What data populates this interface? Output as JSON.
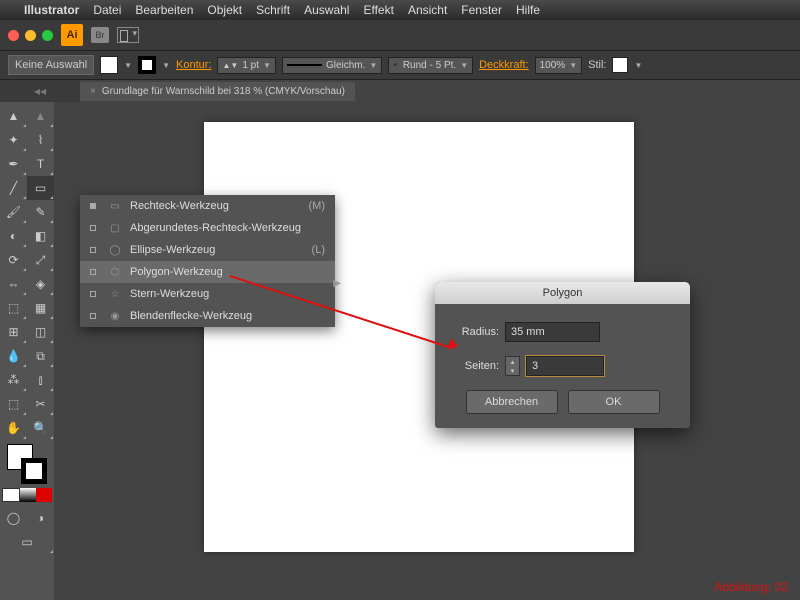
{
  "menubar": {
    "app": "Illustrator",
    "items": [
      "Datei",
      "Bearbeiten",
      "Objekt",
      "Schrift",
      "Auswahl",
      "Effekt",
      "Ansicht",
      "Fenster",
      "Hilfe"
    ]
  },
  "controlbar": {
    "selection": "Keine Auswahl",
    "stroke_label": "Kontur:",
    "stroke_val": "1 pt",
    "dash_label": "Gleichm.",
    "brush_label": "Rund - 5 Pt.",
    "opacity_label": "Deckkraft:",
    "opacity_val": "100%",
    "style_label": "Stil:"
  },
  "doctab": {
    "title": "Grundlage für Warnschild bei 318 % (CMYK/Vorschau)"
  },
  "context_menu": {
    "items": [
      {
        "label": "Rechteck-Werkzeug",
        "shortcut": "(M)",
        "icon": "▭"
      },
      {
        "label": "Abgerundetes-Rechteck-Werkzeug",
        "shortcut": "",
        "icon": "▢"
      },
      {
        "label": "Ellipse-Werkzeug",
        "shortcut": "(L)",
        "icon": "◯"
      },
      {
        "label": "Polygon-Werkzeug",
        "shortcut": "",
        "icon": "⬡"
      },
      {
        "label": "Stern-Werkzeug",
        "shortcut": "",
        "icon": "☆"
      },
      {
        "label": "Blendenflecke-Werkzeug",
        "shortcut": "",
        "icon": "◉"
      }
    ]
  },
  "dialog": {
    "title": "Polygon",
    "radius_label": "Radius:",
    "radius_val": "35 mm",
    "sides_label": "Seiten:",
    "sides_val": "3",
    "cancel": "Abbrechen",
    "ok": "OK"
  },
  "caption": "Abbildung: 02"
}
